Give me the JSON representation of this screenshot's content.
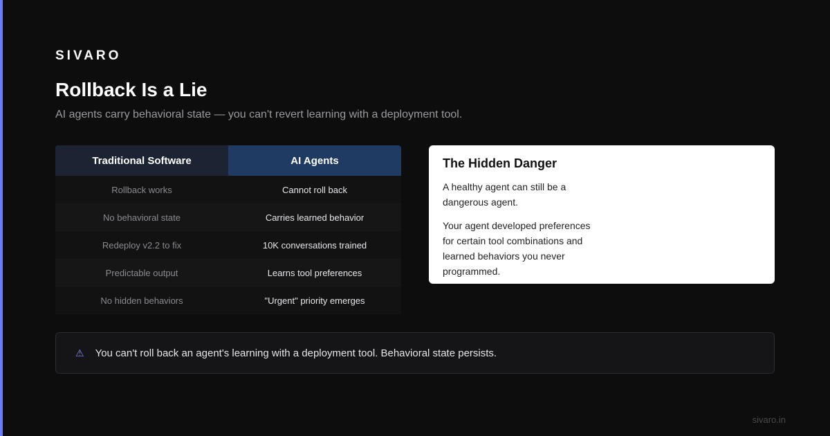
{
  "brand": "SIVARO",
  "title": "Rollback Is a Lie",
  "subtitle": "AI agents carry behavioral state — you can't revert learning with a deployment tool.",
  "comparison": {
    "headers": {
      "left": "Traditional Software",
      "right": "AI Agents"
    },
    "rows": [
      {
        "left": "Rollback works",
        "right": "Cannot roll back"
      },
      {
        "left": "No behavioral state",
        "right": "Carries learned behavior"
      },
      {
        "left": "Redeploy v2.2 to fix",
        "right": "10K conversations trained"
      },
      {
        "left": "Predictable output",
        "right": "Learns tool preferences"
      },
      {
        "left": "No hidden behaviors",
        "right": "\"Urgent\" priority emerges"
      }
    ]
  },
  "danger_card": {
    "title": "The Hidden Danger",
    "paragraphs": [
      "A healthy agent can still be a dangerous agent.",
      "Your agent developed preferences for certain tool combinations and learned behaviors you never programmed."
    ]
  },
  "warning": {
    "icon": "warning-triangle-icon",
    "text": "You can't roll back an agent's learning with a deployment tool. Behavioral state persists."
  },
  "footer_url": "sivaro.in",
  "colors": {
    "accent": "#6b7cff",
    "background": "#0d0d0d",
    "ai_header": "#1f3a63",
    "traditional_header": "#1c2333"
  }
}
